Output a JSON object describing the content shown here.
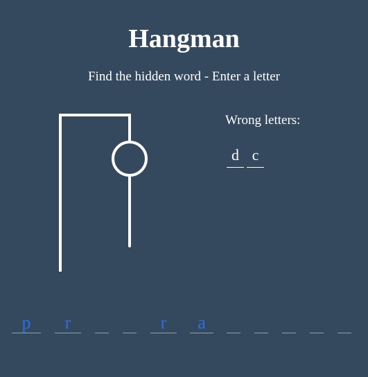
{
  "header": {
    "title": "Hangman",
    "subtitle": "Find the hidden word - Enter a letter"
  },
  "wrong": {
    "label": "Wrong letters:",
    "letters": [
      "d",
      "c"
    ]
  },
  "word": {
    "slots": [
      "p",
      "r",
      "",
      "",
      "r",
      "a",
      "",
      "",
      "",
      "",
      "",
      ""
    ]
  },
  "figure": {
    "parts_shown": [
      "gallows",
      "head",
      "body"
    ]
  },
  "colors": {
    "background": "#34495e",
    "text": "#ffffff",
    "guessed_letter": "#2d6fe0"
  }
}
